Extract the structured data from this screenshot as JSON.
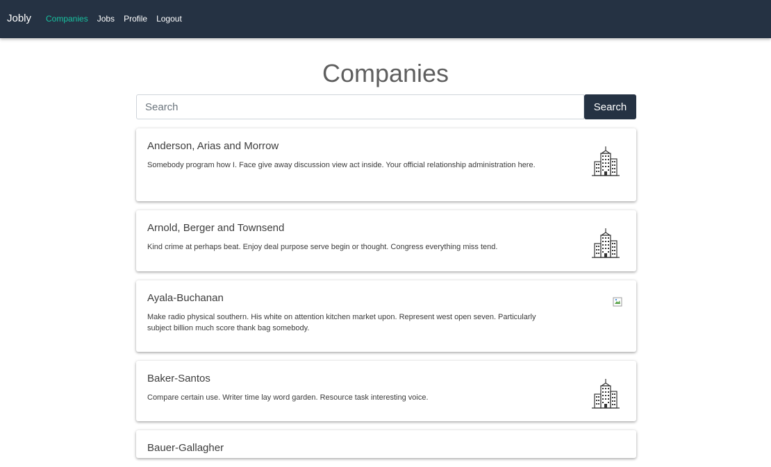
{
  "navbar": {
    "brand": "Jobly",
    "links": [
      {
        "label": "Companies",
        "active": true
      },
      {
        "label": "Jobs",
        "active": false
      },
      {
        "label": "Profile",
        "active": false
      },
      {
        "label": "Logout",
        "active": false
      }
    ],
    "background_color": "#253243",
    "active_color": "#18c1a0"
  },
  "page": {
    "title": "Companies"
  },
  "search": {
    "placeholder": "Search",
    "value": "",
    "button_label": "Search"
  },
  "companies": [
    {
      "name": "Anderson, Arias and Morrow",
      "description": "Somebody program how I. Face give away discussion view act inside. Your official relationship administration here.",
      "logo": "building-icon"
    },
    {
      "name": "Arnold, Berger and Townsend",
      "description": "Kind crime at perhaps beat. Enjoy deal purpose serve begin or thought. Congress everything miss tend.",
      "logo": "building-icon"
    },
    {
      "name": "Ayala-Buchanan",
      "description": "Make radio physical southern. His white on attention kitchen market upon. Represent west open seven. Particularly subject billion much score thank bag somebody.",
      "logo": "broken-image-icon"
    },
    {
      "name": "Baker-Santos",
      "description": "Compare certain use. Writer time lay word garden. Resource task interesting voice.",
      "logo": "building-icon"
    },
    {
      "name": "Bauer-Gallagher",
      "description": "",
      "logo": "building-icon"
    }
  ]
}
